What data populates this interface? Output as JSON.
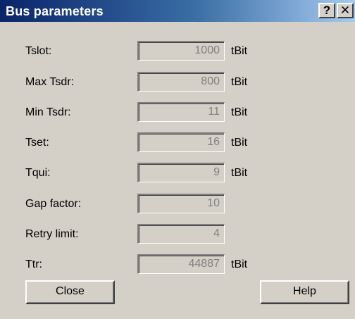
{
  "window": {
    "title": "Bus parameters",
    "help_glyph": "?",
    "close_glyph": "✕"
  },
  "params": [
    {
      "label": "Tslot:",
      "value": "1000",
      "unit": "tBit"
    },
    {
      "label": "Max Tsdr:",
      "value": "800",
      "unit": "tBit"
    },
    {
      "label": "Min Tsdr:",
      "value": "11",
      "unit": "tBit"
    },
    {
      "label": "Tset:",
      "value": "16",
      "unit": "tBit"
    },
    {
      "label": "Tqui:",
      "value": "9",
      "unit": "tBit"
    },
    {
      "label": "Gap factor:",
      "value": "10",
      "unit": ""
    },
    {
      "label": "Retry limit:",
      "value": "4",
      "unit": ""
    },
    {
      "label": "Ttr:",
      "value": "44887",
      "unit": "tBit"
    }
  ],
  "buttons": {
    "close_label": "Close",
    "help_label": "Help"
  }
}
